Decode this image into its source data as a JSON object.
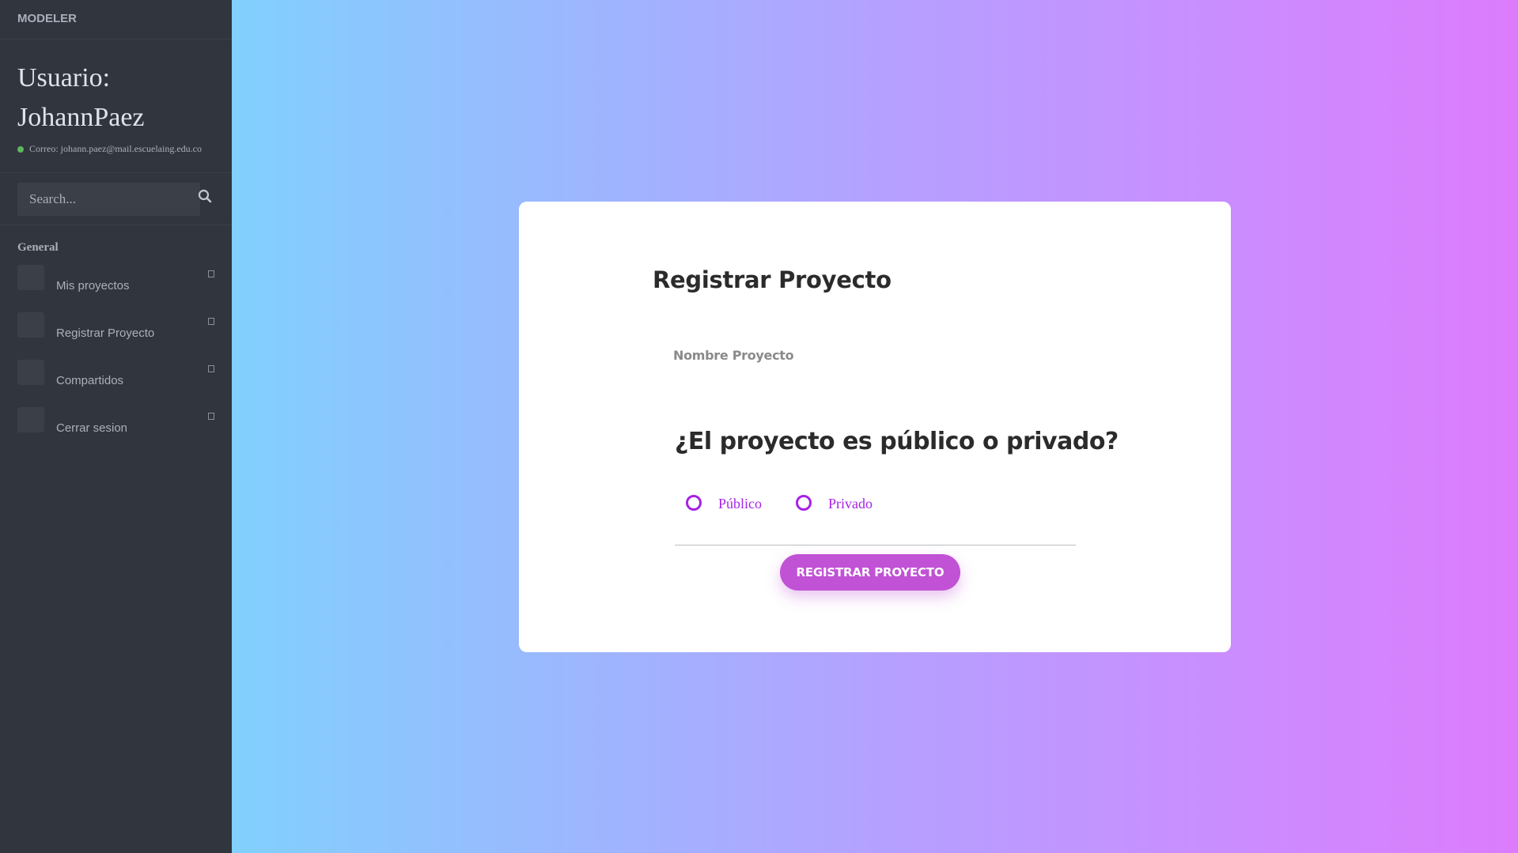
{
  "sidebar": {
    "brand": "MODELER",
    "user_label": "Usuario: JohannPaez",
    "email": "Correo: johann.paez@mail.escuelaing.edu.co",
    "search_placeholder": "Search...",
    "section_title": "General",
    "items": [
      {
        "label": "Mis proyectos"
      },
      {
        "label": "Registrar Proyecto"
      },
      {
        "label": "Compartidos"
      },
      {
        "label": "Cerrar sesion"
      }
    ],
    "online_color": "#5cb85c",
    "background": "#31353d"
  },
  "form": {
    "title": "Registrar Proyecto",
    "name_label": "Nombre Proyecto",
    "question": "¿El proyecto es público o privado?",
    "options": [
      {
        "label": "Público"
      },
      {
        "label": "Privado"
      }
    ],
    "submit_label": "REGISTRAR PROYECTO",
    "accent_color": "#a523e6",
    "button_color": "#c152d5"
  },
  "background_gradient": [
    "#81d0fe",
    "#b4a1ff",
    "#dc7cfd"
  ]
}
